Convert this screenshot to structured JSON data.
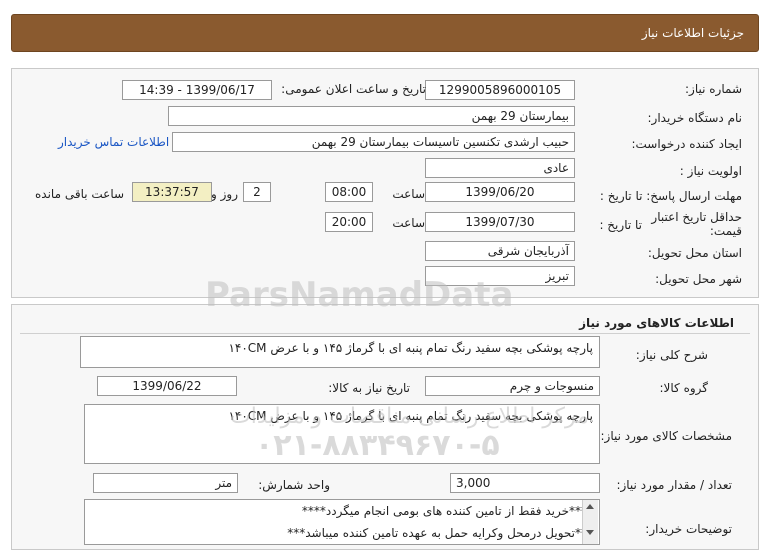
{
  "header": {
    "title": "جزئیات اطلاعات نیاز"
  },
  "labels": {
    "need_number": "شماره نیاز:",
    "announce_datetime": "تاریخ و ساعت اعلان عمومی:",
    "buyer_org": "نام دستگاه خریدار:",
    "requester": "ایجاد کننده درخواست:",
    "priority": "اولویت نیاز :",
    "reply_deadline": "مهلت ارسال پاسخ: تا تاریخ :",
    "time": "ساعت",
    "day_and": "روز و",
    "remaining": "ساعت باقی مانده",
    "price_validity": "حداقل تاریخ اعتبار قیمت:",
    "until_date": "تا تاریخ :",
    "province": "استان محل تحویل:",
    "city": "شهر محل تحویل:"
  },
  "values": {
    "need_number": "1299005896000105",
    "announce_datetime": "1399/06/17 - 14:39",
    "buyer_org": "بیمارستان 29 بهمن",
    "requester": "حبیب ارشدی تکنسین تاسیسات بیمارستان 29 بهمن",
    "contact_link": "اطلاعات تماس خریدار",
    "priority": "عادی",
    "reply_date": "1399/06/20",
    "reply_time": "08:00",
    "days": "2",
    "remaining_time": "13:37:57",
    "validity_date": "1399/07/30",
    "validity_time": "20:00",
    "province": "آذربایجان شرقی",
    "city": "تبریز"
  },
  "goods": {
    "title": "اطلاعات کالاهای مورد نیاز",
    "general_desc_label": "شرح کلی نیاز:",
    "general_desc": "پارچه پوشکی بچه سفید رنگ تمام پنبه ای با گرماژ ۱۴۵ و با عرض ۱۴۰CM",
    "group_label": "گروه کالا:",
    "group": "منسوجات و چرم",
    "need_date_label": "تاریخ نیاز به کالا:",
    "need_date": "1399/06/22",
    "spec_label": "مشخصات کالای مورد نیاز:",
    "spec": "پارچه پوشکی بچه سفید رنگ تمام پنبه ای با گرماژ ۱۴۵ و با عرض ۱۴۰CM",
    "qty_label": "تعداد / مقدار مورد نیاز:",
    "qty": "3,000",
    "unit_label": "واحد شمارش:",
    "unit": "متر",
    "buyer_notes_label": "توضیحات خریدار:",
    "buyer_notes": [
      "****خرید فقط از تامین کننده های بومی انجام میگردد****",
      "***تحویل درمحل وکرایه حمل به عهده تامین کننده میباشد***"
    ]
  },
  "watermark": {
    "brand": "ParsNamadData",
    "line1": "مرکز اطلاع رسانی مناقصات و مزایدات",
    "phone": "۰۲۱-۸۸۳۴۹۶۷۰-۵"
  }
}
